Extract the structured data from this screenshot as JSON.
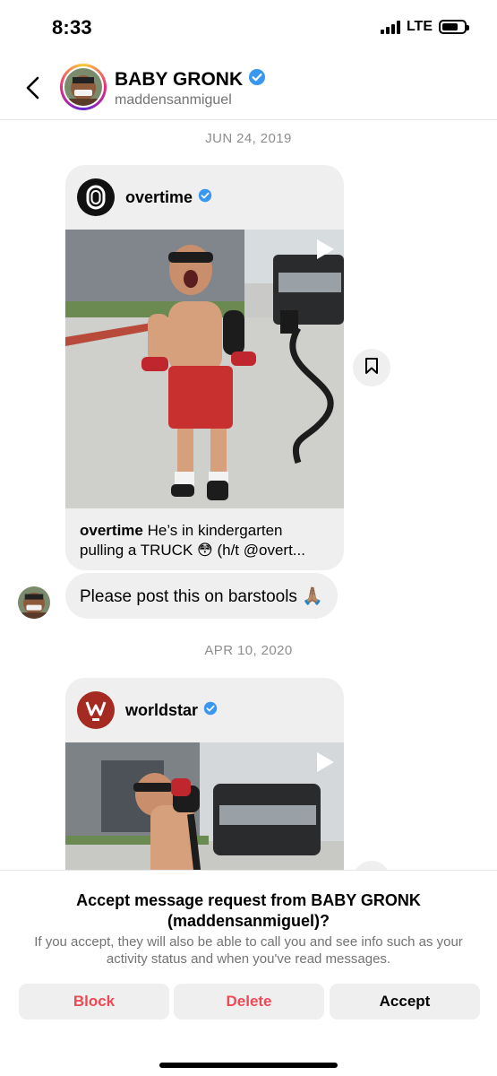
{
  "status_bar": {
    "time": "8:33",
    "network": "LTE"
  },
  "header": {
    "name": "BABY GRONK",
    "username": "maddensanmiguel"
  },
  "messages": {
    "date1": "JUN 24, 2019",
    "post1": {
      "account": "overtime",
      "caption_account": "overtime",
      "caption_text": "He’s in kindergarten pulling a TRUCK 😳 (h/t @overt..."
    },
    "reply": "Please post this on barstools 🙏🏽",
    "date2": "APR 10, 2020",
    "post2": {
      "account": "worldstar"
    }
  },
  "request": {
    "title": "Accept message request from BABY GRONK (maddensanmiguel)?",
    "description": "If you accept, they will also be able to call you and see info such as your activity status and when you've read messages.",
    "block_label": "Block",
    "delete_label": "Delete",
    "accept_label": "Accept"
  },
  "colors": {
    "verified": "#3897f0",
    "danger": "#ed4956",
    "bubble": "#efefef"
  }
}
